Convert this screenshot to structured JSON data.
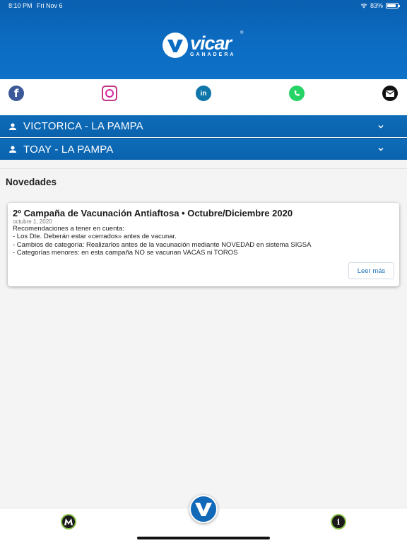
{
  "status_bar": {
    "time": "8:10 PM",
    "date": "Fri Nov 6",
    "battery": "83%"
  },
  "brand": {
    "name": "vicar",
    "subtitle": "GANADERA",
    "reg_mark": "®"
  },
  "social": {
    "facebook_glyph": "f",
    "linkedin_glyph": "in"
  },
  "locations": [
    {
      "label": "VICTORICA - LA PAMPA"
    },
    {
      "label": "TOAY - LA PAMPA"
    }
  ],
  "news": {
    "section_title": "Novedades",
    "items": [
      {
        "title": "2º Campaña de Vacunación Antiaftosa • Octubre/Diciembre 2020",
        "date": "octubre 1, 2020",
        "lines": [
          "Recomendaciones a tener en cuenta:",
          "- Los Dte. Deberán estar «cerrados» antes de vacunar.",
          "- Cambios de categoría: Realizarlos antes de la vacunación mediante NOVEDAD en sistema SIGSA",
          "- Categorías menores: en esta campaña NO se vacunan VACAS ni TOROS"
        ],
        "read_more": "Leer más"
      }
    ]
  },
  "bottom_nav": {
    "info_glyph": "i"
  },
  "colors": {
    "header_blue": "#0c6cc2",
    "row_blue": "#0e6cb8",
    "link_blue": "#1a6fb8",
    "accent_green": "#8bc34a"
  }
}
